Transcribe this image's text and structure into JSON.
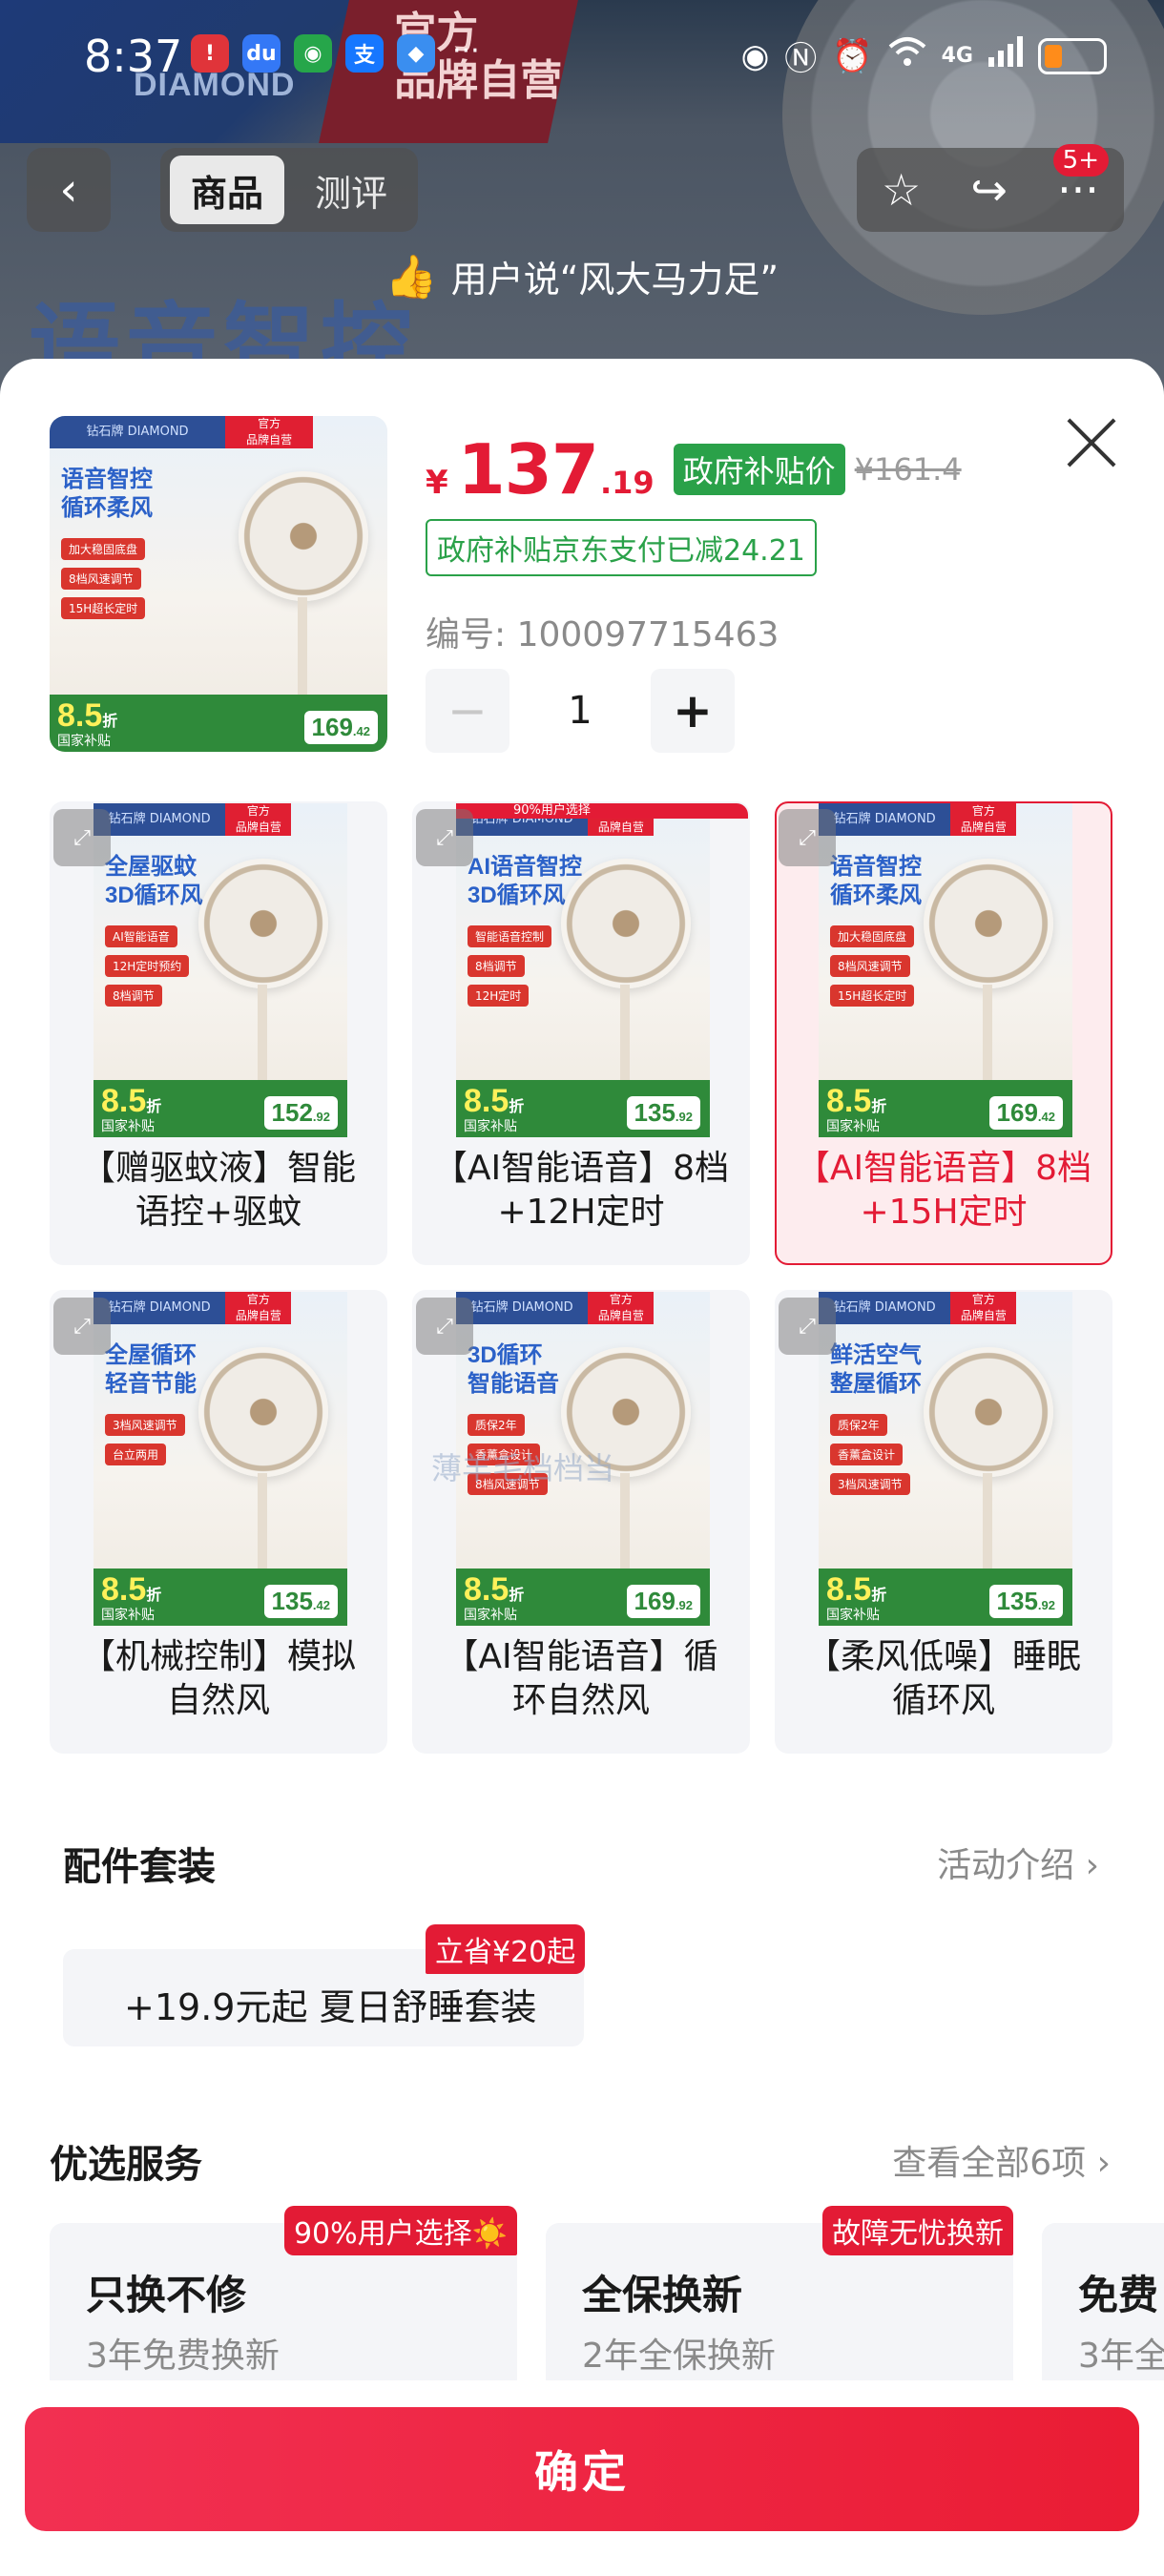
{
  "status_bar": {
    "time": "8:37",
    "network": "4G",
    "apps": [
      {
        "name": "red-app",
        "glyph": "!",
        "color": "#e0343a"
      },
      {
        "name": "baidu-map",
        "glyph": "du",
        "color": "#3478f6"
      },
      {
        "name": "china-mobile",
        "glyph": "◉",
        "color": "#26a64a"
      },
      {
        "name": "alipay",
        "glyph": "支",
        "color": "#1677ff"
      },
      {
        "name": "blue-cube",
        "glyph": "◆",
        "color": "#3a8ef0"
      }
    ],
    "more": "···"
  },
  "background": {
    "brand_left": "DIAMOND",
    "brand_right": "官方\n品牌自营",
    "headline": "语音智控"
  },
  "nav": {
    "tabs": [
      "商品",
      "测评"
    ],
    "active_tab": 0,
    "badge": "5+"
  },
  "review_banner": "用户说“风大马力足”",
  "product": {
    "yen": "¥",
    "price_int": "137",
    "price_dec": ".19",
    "gov_badge": "政府补贴价",
    "orig_price": "¥161.4",
    "subsidy_note": "政府补贴京东支付已减24.21",
    "sku": "编号: 100097715463",
    "quantity": "1",
    "image": {
      "headline": "语音智控\n循环柔风",
      "tags": [
        "加大稳固底盘",
        "8档风速调节",
        "15H超长定时"
      ],
      "discount": "8.5",
      "price": "169",
      "price_dec": ".42"
    }
  },
  "variants": [
    {
      "label": "【赠驱蚊液】智能语控+驱蚊",
      "selected": false,
      "headline": "全屋驱蚊\n3D循环风",
      "tags": [
        "AI智能语音",
        "12H定时预约",
        "8档调节"
      ],
      "discount": "8.5",
      "price": "152",
      "price_dec": ".92"
    },
    {
      "label": "【AI智能语音】8档+12H定时",
      "selected": false,
      "headline": "AI语音智控\n3D循环风",
      "tags": [
        "智能语音控制",
        "8档调节",
        "12H定时"
      ],
      "discount": "8.5",
      "price": "135",
      "price_dec": ".92",
      "overlay": "90%用户选择"
    },
    {
      "label": "【AI智能语音】8档+15H定时",
      "selected": true,
      "headline": "语音智控\n循环柔风",
      "tags": [
        "加大稳固底盘",
        "8档风速调节",
        "15H超长定时"
      ],
      "discount": "8.5",
      "price": "169",
      "price_dec": ".42"
    },
    {
      "label": "【机械控制】模拟自然风",
      "selected": false,
      "headline": "全屋循环\n轻音节能",
      "tags": [
        "3档风速调节",
        "台立两用"
      ],
      "discount": "8.5",
      "price": "135",
      "price_dec": ".42"
    },
    {
      "label": "【AI智能语音】循环自然风",
      "selected": false,
      "headline": "3D循环\n智能语音",
      "tags": [
        "质保2年",
        "香薰盒设计",
        "8档风速调节"
      ],
      "discount": "8.5",
      "price": "169",
      "price_dec": ".92"
    },
    {
      "label": "【柔风低噪】睡眠循环风",
      "selected": false,
      "headline": "鲜活空气\n整屋循环",
      "tags": [
        "质保2年",
        "香薰盒设计",
        "3档风速调节"
      ],
      "discount": "8.5",
      "price": "135",
      "price_dec": ".92"
    }
  ],
  "image_common": {
    "logo": "钻石牌 DIAMOND",
    "logo_badge": "官方\n品牌自营",
    "gov_label": "国家补贴",
    "fold": "折"
  },
  "watermark": "薄羊毛档档当",
  "accessories": {
    "title": "配件套装",
    "link": "活动介绍",
    "card": "+19.9元起  夏日舒睡套装",
    "badge": "立省¥20起"
  },
  "services": {
    "title": "优选服务",
    "link": "查看全部6项",
    "items": [
      {
        "title": "只换不修",
        "subtitle": "3年免费换新",
        "badge": "90%用户选择☀️"
      },
      {
        "title": "全保换新",
        "subtitle": "2年全保换新",
        "badge": "故障无忧换新"
      },
      {
        "title": "免费",
        "subtitle": "3年全",
        "badge": ""
      }
    ]
  },
  "confirm": "确定"
}
